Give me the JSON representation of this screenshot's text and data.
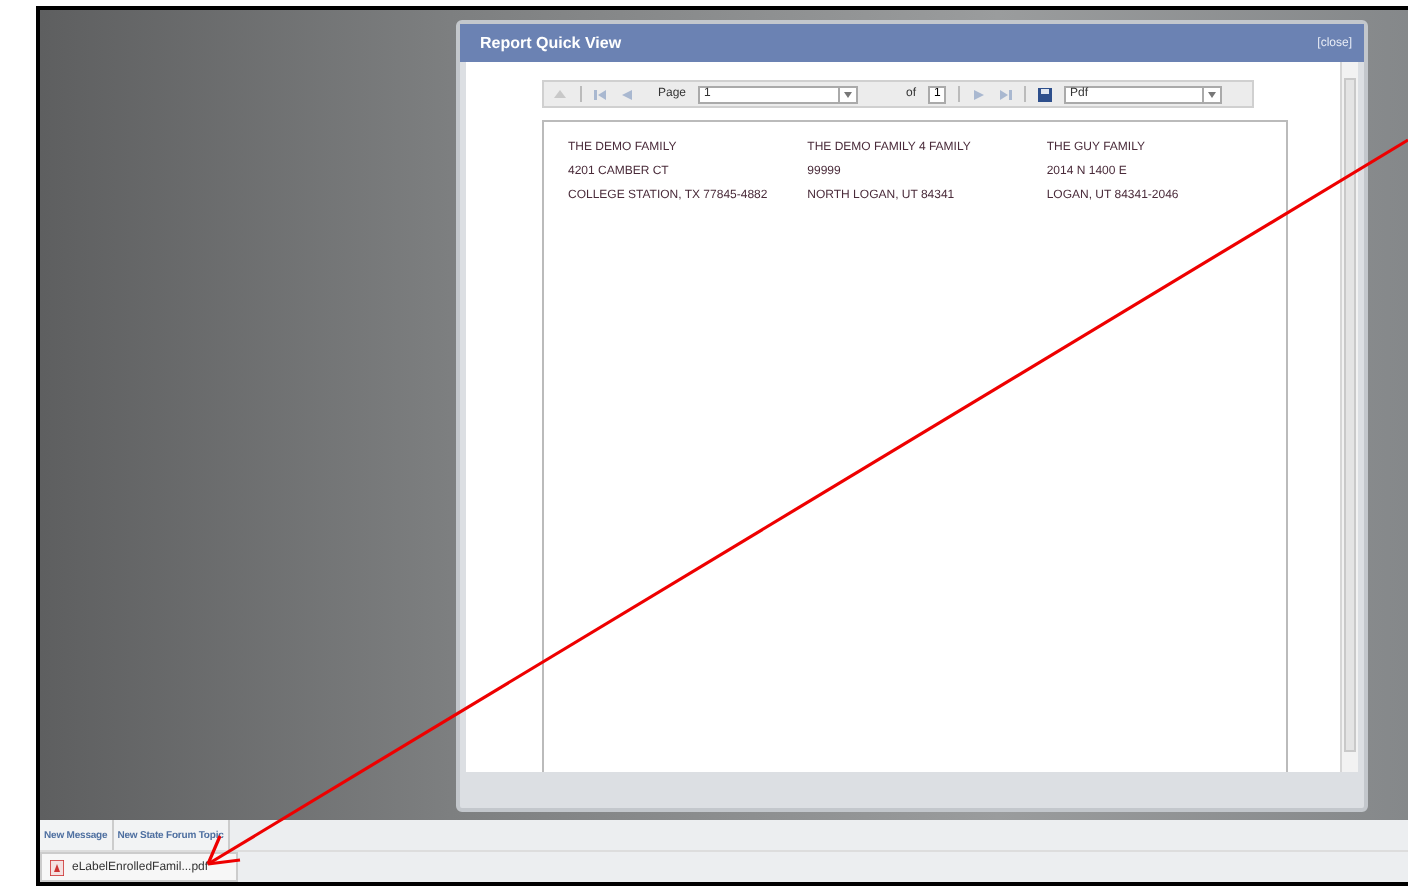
{
  "dialog": {
    "title": "Report Quick View",
    "close": "[close]"
  },
  "toolbar": {
    "page_label": "Page",
    "page": "1",
    "of_label": "of",
    "page_count": "1",
    "format": "Pdf"
  },
  "addresses": [
    {
      "lines": [
        "THE DEMO FAMILY",
        "4201 CAMBER CT",
        "COLLEGE STATION, TX 77845-4882"
      ]
    },
    {
      "lines": [
        "THE DEMO FAMILY 4 FAMILY",
        "99999",
        "NORTH LOGAN, UT 84341"
      ]
    },
    {
      "lines": [
        "THE GUY FAMILY",
        "2014 N 1400 E",
        "LOGAN, UT 84341-2046"
      ]
    }
  ],
  "tabs": [
    {
      "label": "New Message"
    },
    {
      "label": "New State Forum Topic"
    }
  ],
  "downloads": [
    {
      "file": "eLabelEnrolledFamil...pdf"
    }
  ]
}
